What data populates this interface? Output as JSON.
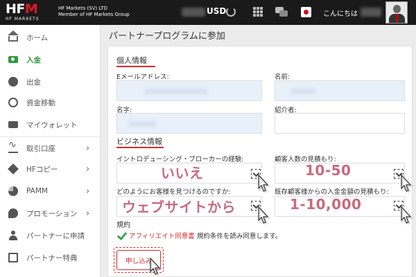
{
  "header": {
    "logo_text_left": "HF",
    "logo_text_m": "M",
    "logo_sub": "HF MARKETS",
    "company_line1": "HF Markets (SV) LTD",
    "company_line2": "Member of HF Markets Group",
    "currency": "USD",
    "greeting": "こんにちは"
  },
  "sidebar": {
    "items": [
      {
        "label": "ホーム",
        "icon": "home-icon"
      },
      {
        "label": "入金",
        "icon": "deposit-icon"
      },
      {
        "label": "出金",
        "icon": "withdraw-icon"
      },
      {
        "label": "資金移動",
        "icon": "transfer-icon"
      },
      {
        "label": "マイウォレット",
        "icon": "wallet-icon"
      },
      {
        "label": "取引口座",
        "icon": "trading-account-icon"
      },
      {
        "label": "HFコピー",
        "icon": "copy-trading-icon"
      },
      {
        "label": "PAMM",
        "icon": "pamm-icon"
      },
      {
        "label": "プロモーション",
        "icon": "promotion-icon"
      },
      {
        "label": "パートナーに申請",
        "icon": "partner-apply-icon"
      },
      {
        "label": "パートナー特典",
        "icon": "partner-perks-icon"
      }
    ],
    "active_color": "#2d9a3c"
  },
  "main": {
    "page_title": "パートナープログラムに参加",
    "personal": {
      "title": "個人情報",
      "email_label": "Eメールアドレス:",
      "first_name_label": "名前:",
      "last_name_label": "名字:",
      "referrer_label": "紹介者:"
    },
    "business": {
      "title": "ビジネス情報",
      "ib_experience_label": "イントロデューシング・ブローカーの経験:",
      "ib_experience_value": "いいえ",
      "clients_label": "顧客人数の見積もり:",
      "clients_value": "10-50",
      "how_find_label": "どのようにお客様を見つけるのですか:",
      "how_find_value": "ウェブサイトから",
      "deposit_label": "既存顧客様からの入金金額の見積もり:",
      "deposit_value": "1-10,000"
    },
    "terms": {
      "title": "規約",
      "link_text": "アフィリエイト同意書",
      "text": "規約条件を読み同意します。"
    },
    "submit_label": "申し込み"
  },
  "colors": {
    "accent_red": "#d62b2b",
    "value_pink": "#c9697d",
    "header_bg": "#1a1a1a"
  }
}
